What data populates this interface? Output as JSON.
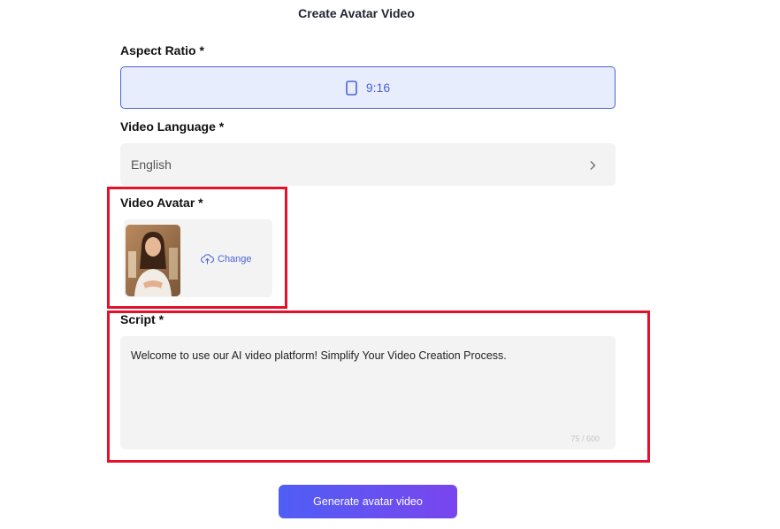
{
  "page": {
    "title": "Create Avatar Video"
  },
  "aspect_ratio": {
    "label": "Aspect Ratio *",
    "value": "9:16",
    "icon": "portrait-phone-icon",
    "accent": "#4a63d8"
  },
  "video_language": {
    "label": "Video Language *",
    "value": "English",
    "icon": "chevron-right-icon"
  },
  "video_avatar": {
    "label": "Video Avatar *",
    "change_label": "Change",
    "change_icon": "cloud-upload-icon"
  },
  "script": {
    "label": "Script *",
    "text": "Welcome to use our AI video platform! Simplify Your Video Creation Process.",
    "counter": "75 / 600"
  },
  "actions": {
    "generate_label": "Generate avatar video"
  },
  "colors": {
    "highlight": "#e4112b",
    "button_start": "#4f5ef5",
    "button_end": "#7a45ee"
  }
}
